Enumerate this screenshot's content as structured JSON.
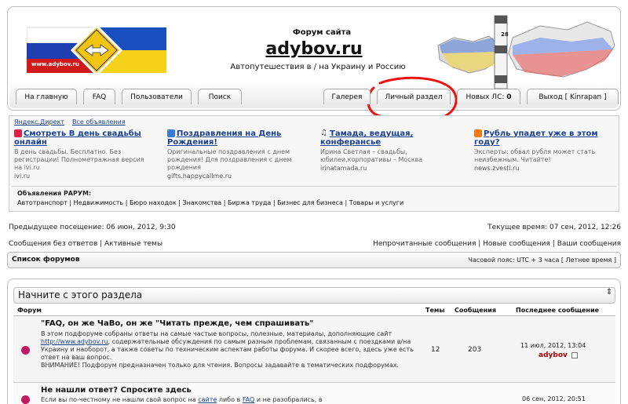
{
  "header": {
    "logo_url_text": "www.adybov.ru",
    "subtitle": "Форум сайта",
    "title": "adybov.ru",
    "description": "Автопутешествия в / на Украину и Россию",
    "milepost_number": "28"
  },
  "nav": {
    "left": [
      "На главную",
      "FAQ",
      "Пользователи",
      "Поиск"
    ],
    "gallery": "Галерея",
    "personal": "Личный раздел",
    "new_pm": "Новых ЛС:",
    "new_pm_count": "0",
    "logout": "Выход [ Kinrapan ]"
  },
  "ads": {
    "yandex_direct": "Яндекс.Директ",
    "all_ads": "Все объявления",
    "items": [
      {
        "title": "Смотреть В день свадьбы онлайн",
        "text": "В день свадьбы. Бесплатно. Без регистрации! Полнометражная версия на ivi.ru",
        "url": "ivi.ru",
        "icon": "ivi-icon"
      },
      {
        "title": "Поздравления на День Рождения!",
        "text": "Оригинальные поздравления с днем рождения! Для поздравления с днем рождения",
        "url": "gifts.happycallme.ru",
        "icon": "gift-icon"
      },
      {
        "title": "Тамада, ведущая, конферансье",
        "text": "Ирина Светлая – свадьбы, юбилеи,корпоративы – Москва",
        "url": "irinatamada.ru",
        "icon": "music-note-icon"
      },
      {
        "title": "Рубль упадет уже в этом году?",
        "text": "Эксперты: обвал рубля может стать неизбежным. Читайте!",
        "url": "news.zvesti.ru",
        "icon": "coin-icon"
      }
    ],
    "rarum_label": "Объявления РАРУМ:",
    "categories": [
      "Автотранспорт",
      "Недвижимость",
      "Бюро находок",
      "Знакомства",
      "Биржа труда",
      "Бизнес для бизнеса",
      "Товары и услуги"
    ]
  },
  "info": {
    "last_visit": "Предыдущее посещение: 06 июн, 2012, 9:30",
    "current_time": "Текущее время: 07 сен, 2012, 12:26",
    "unanswered": "Сообщения без ответов",
    "active": "Активные темы",
    "unread": "Непрочитанные сообщения",
    "new_posts": "Новые сообщения",
    "your_posts": "Ваши сообщения",
    "forum_list": "Список форумов",
    "timezone": "Часовой пояс: UTC + 3 часа [ Летнее время ]"
  },
  "forums": {
    "section_title": "Начните с этого раздела",
    "col_forum": "Форум",
    "col_topics": "Темы",
    "col_posts": "Сообщения",
    "col_last": "Последнее сообщение",
    "rows": [
      {
        "title": "\"FAQ, он же ЧаВо, он же \"Читать прежде, чем спрашивать\"",
        "desc_1": "В этом подфоруме собраны ответы на самые частые вопросы, полезные, материалы, дополняющие сайт ",
        "desc_link": "http://www.adybov.ru",
        "desc_2": ", содержательные обсуждения по самым разным проблемам, связанным с поездками в/на Украину и наоборот, а также советы по техническим аспектам работы форума. И скорее всего, здесь уже есть ответ на ваш вопрос.",
        "desc_3": "ВНИМАНИЕ! Подфорум предназначен только для чтения. Вопросы задавайте в тематических подфорумах.",
        "topics": "12",
        "posts": "203",
        "last_date": "11 июл, 2012, 13:04",
        "last_user": "adybov"
      },
      {
        "title": "Не нашли ответ? Спросите здесь",
        "desc_1": "Если вы по-честному не нашли свой вопрос на ",
        "desc_link": "сайте",
        "desc_mid": " либо в ",
        "desc_link2": "FAQ",
        "desc_2": " и не разобрались, в",
        "topics": "",
        "posts": "",
        "last_date": "06 сен, 2012, 20:51",
        "last_user": ""
      }
    ]
  },
  "colors": {
    "link": "#1a3f8c",
    "user": "#aa0000",
    "annotation": "#ee1111"
  }
}
